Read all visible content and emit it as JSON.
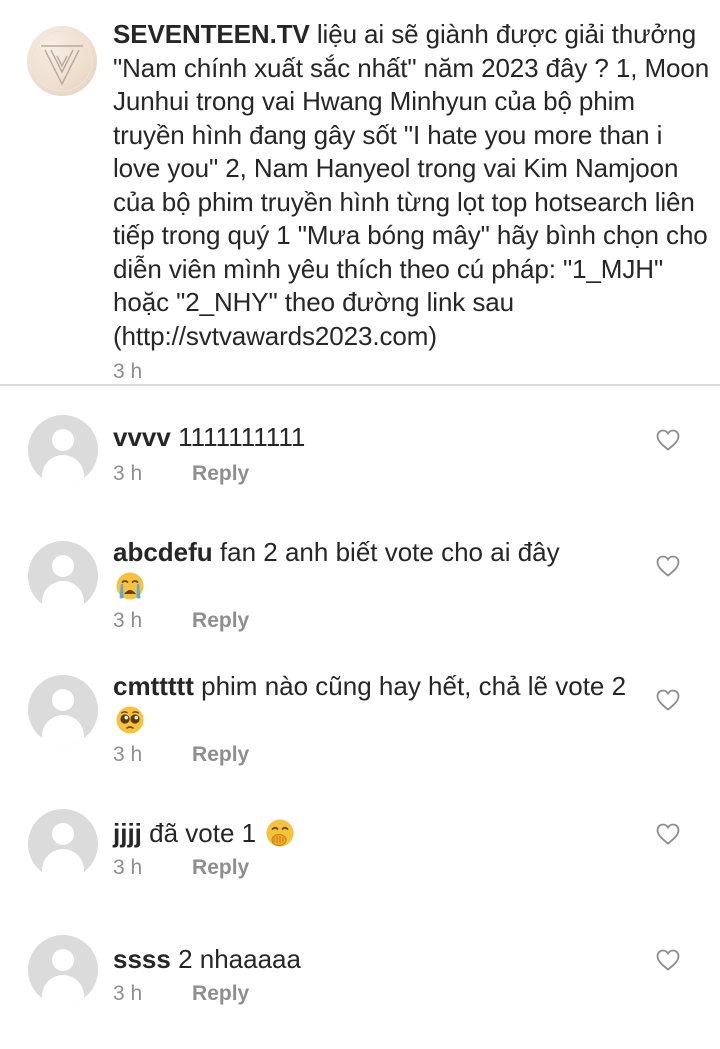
{
  "post": {
    "username": "SEVENTEEN.TV",
    "caption": "liệu ai sẽ giành được giải thưởng \"Nam chính xuất sắc nhất\" năm 2023 đây ? 1, Moon Junhui trong vai Hwang Minhyun của bộ phim truyền hình đang gây sốt \"I hate you more than i love you\" 2, Nam Hanyeol trong vai Kim Namjoon của bộ phim truyền hình từng lọt top hotsearch liên tiếp trong quý 1 \"Mưa bóng mây\" hãy bình chọn cho diễn viên mình yêu thích theo cú pháp: \"1_MJH\" hoặc \"2_NHY\" theo đường link sau (http://svtvawards2023.com)",
    "time": "3 h"
  },
  "reply_label": "Reply",
  "comments": [
    {
      "username": "vvvv",
      "text": "1111111111",
      "emoji": "",
      "time": "3 h"
    },
    {
      "username": "abcdefu",
      "text": "fan 2 anh biết vote cho ai đây",
      "emoji": "crying-face",
      "time": "3 h"
    },
    {
      "username": "cmttttt",
      "text": "phim nào cũng hay hết, chả lẽ vote 2",
      "emoji": "pleading-face",
      "time": "3 h"
    },
    {
      "username": "jjjj",
      "text": "đã vote 1",
      "emoji": "hand-over-mouth-face",
      "time": "3 h"
    },
    {
      "username": "ssss",
      "text": "2 nhaaaaa",
      "emoji": "",
      "time": "3 h"
    }
  ],
  "colors": {
    "text": "#262626",
    "secondary": "#8e8e8e",
    "divider": "#dbdbdb",
    "avatar_placeholder": "#dbdbdb"
  }
}
